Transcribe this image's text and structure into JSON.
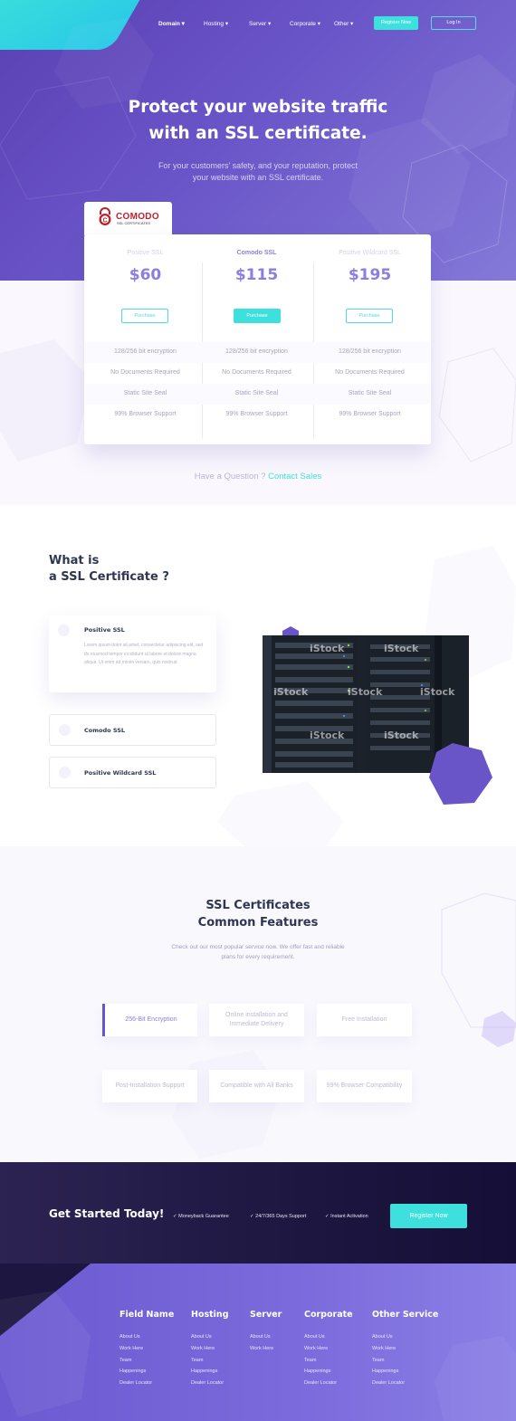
{
  "nav": {
    "items": [
      "Domain ▾",
      "Hosting ▾",
      "Server ▾",
      "Corporate ▾",
      "Other ▾"
    ],
    "register_label": "Register Now",
    "login_label": "Log In"
  },
  "hero": {
    "title_line1": "Protect your website traffic",
    "title_line2": "with an SSL certificate.",
    "subtitle_line1": "For your customers’ safety, and your reputation, protect",
    "subtitle_line2": "your website with an SSL certificate."
  },
  "brand": {
    "logo_text": "COMODO",
    "logo_sub": "SSL CERTIFICATES",
    "logo_color": "#c01f2e"
  },
  "plans": [
    {
      "name": "Positive SSL",
      "price": "$60",
      "button": "Purchase"
    },
    {
      "name": "Comodo SSL",
      "price": "$115",
      "button": "Purchase"
    },
    {
      "name": "Positive Wildcard SSL",
      "price": "$195",
      "button": "Purchase"
    }
  ],
  "plan_features": [
    "128/256 bit encryption",
    "No Documents Required",
    "Static Site Seal",
    "99% Browser Support"
  ],
  "question": {
    "text": "Have a Question ? ",
    "link": "Contact Sales"
  },
  "what_is": {
    "title_line1": "What is",
    "title_line2": "a SSL Certificate ?",
    "items": [
      {
        "title": "Positive SSL",
        "body": "Lorem ipsum dolor sit amet, consectetur adipiscing elit, sed do eiusmod tempor incididunt ut labore et dolore magna aliqua. Ut enim ad minim veniam, quis nostrud"
      },
      {
        "title": "Comodo SSL"
      },
      {
        "title": "Positive Wildcard SSL"
      }
    ],
    "watermark": "iStock",
    "watermark_sub": "by Getty Images"
  },
  "features": {
    "title_line1": "SSL Certificates",
    "title_line2": "Common Features",
    "subtitle_line1": "Check out our most popular service now. We offer fast and reliable",
    "subtitle_line2": "plans for every requirement.",
    "items": [
      "256-Bit Encryption",
      "Online installation and Immediate Delivery",
      "Free Installation",
      "Post-Installation Support",
      "Compatible with All Banks",
      "99% Browser Compatibility"
    ]
  },
  "cta": {
    "title": "Get Started Today!",
    "checks": [
      "Moneyback Guarantee",
      "24/7/365 Days Support",
      "Instant Activation"
    ],
    "button": "Register Now"
  },
  "footer": {
    "columns": [
      {
        "title": "Field Name",
        "links": [
          "About Us",
          "Work Here",
          "Team",
          "Happenings",
          "Dealer Locator"
        ]
      },
      {
        "title": "Hosting",
        "links": [
          "About Us",
          "Work Here",
          "Team",
          "Happenings",
          "Dealer Locator"
        ]
      },
      {
        "title": "Server",
        "links": [
          "About Us",
          "Work Here"
        ]
      },
      {
        "title": "Corporate",
        "links": [
          "About Us",
          "Work Here",
          "Team",
          "Happenings",
          "Dealer Locator"
        ]
      },
      {
        "title": "Other Service",
        "links": [
          "About Us",
          "Work Here",
          "Team",
          "Happenings",
          "Dealer Locator"
        ]
      }
    ]
  },
  "colors": {
    "accent": "#3ee0dd",
    "primary": "#6a55c8",
    "price": "#8a7fe0",
    "dark": "#1c1640"
  }
}
